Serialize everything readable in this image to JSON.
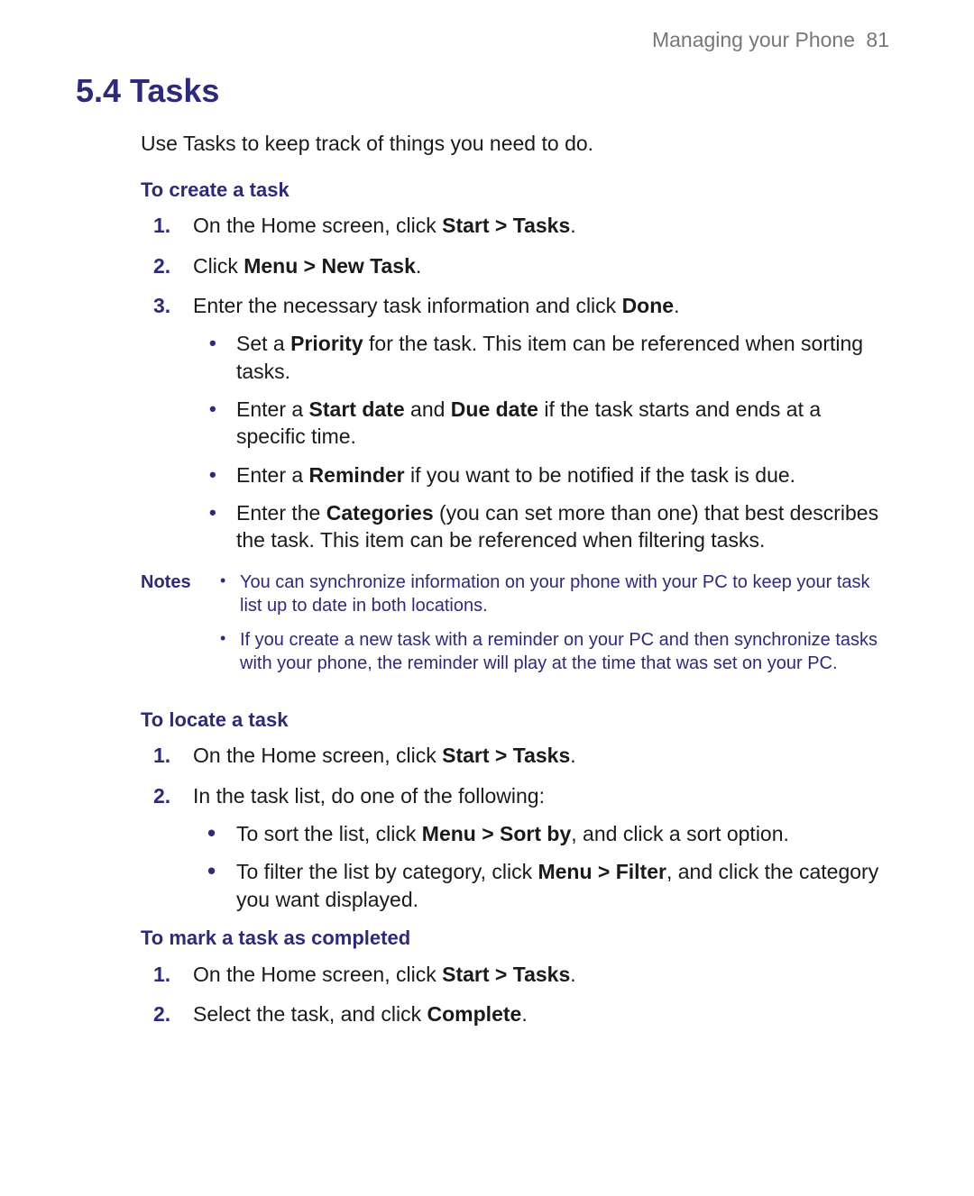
{
  "header": {
    "chapter": "Managing your Phone",
    "page": "81"
  },
  "title": "5.4 Tasks",
  "intro": "Use Tasks to keep track of things you need to do.",
  "sections": {
    "create": {
      "heading": "To create a task",
      "steps": {
        "s1": {
          "num": "1.",
          "pre": "On the Home screen, click ",
          "b": "Start > Tasks",
          "post": "."
        },
        "s2": {
          "num": "2.",
          "pre": "Click ",
          "b": "Menu > New Task",
          "post": "."
        },
        "s3": {
          "num": "3.",
          "pre": "Enter the necessary task information and click ",
          "b": "Done",
          "post": "."
        }
      },
      "bullets": {
        "b1": {
          "pre": "Set a ",
          "b1": "Priority",
          "mid": " for the task. This item can be referenced when sorting tasks."
        },
        "b2": {
          "pre": "Enter a ",
          "b1": "Start date",
          "mid": " and ",
          "b2": "Due date",
          "post": " if the task starts and ends at a specific time."
        },
        "b3": {
          "pre": "Enter a ",
          "b1": "Reminder",
          "mid": " if you want to be notified if the task is due."
        },
        "b4": {
          "pre": "Enter the ",
          "b1": "Categories",
          "mid": " (you can set more than one) that best describes the task. This item can be referenced when filtering tasks."
        }
      }
    },
    "notes": {
      "label": "Notes",
      "n1": "You can synchronize information on your phone with your PC to keep your task list up to date in both locations.",
      "n2": "If you create a new task with a reminder on your PC and then synchronize tasks with your phone, the reminder will play at the time that was set on your PC."
    },
    "locate": {
      "heading": "To locate a task",
      "steps": {
        "s1": {
          "num": "1.",
          "pre": "On the Home screen, click ",
          "b": "Start > Tasks",
          "post": "."
        },
        "s2": {
          "num": "2.",
          "text": "In the task list, do one of the following:"
        }
      },
      "bullets": {
        "b1": {
          "pre": "To sort the list, click ",
          "b1": "Menu > Sort by",
          "post": ", and click a sort option."
        },
        "b2": {
          "pre": "To filter the list by category, click ",
          "b1": "Menu > Filter",
          "post": ", and click the category you want displayed."
        }
      }
    },
    "complete": {
      "heading": "To mark a task as completed",
      "steps": {
        "s1": {
          "num": "1.",
          "pre": "On the Home screen, click ",
          "b": "Start > Tasks",
          "post": "."
        },
        "s2": {
          "num": "2.",
          "pre": "Select the task, and click ",
          "b": "Complete",
          "post": "."
        }
      }
    }
  }
}
